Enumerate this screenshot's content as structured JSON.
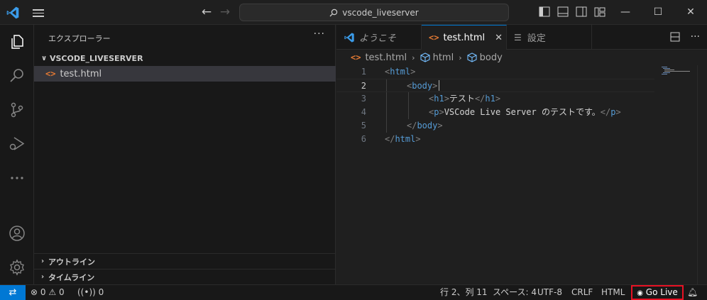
{
  "titlebar": {
    "search_text": "vscode_liveserver",
    "minimize": "—",
    "maximize": "☐",
    "close": "✕"
  },
  "sidebar": {
    "header": "エクスプローラー",
    "more": "···",
    "folder": "VSCODE_LIVESERVER",
    "file": "test.html",
    "outline": "アウトライン",
    "timeline": "タイムライン"
  },
  "tabs": [
    {
      "label": "ようこそ"
    },
    {
      "label": "test.html"
    },
    {
      "label": "設定"
    }
  ],
  "breadcrumb": [
    "test.html",
    "html",
    "body"
  ],
  "editor": {
    "line_numbers": [
      "1",
      "2",
      "3",
      "4",
      "5",
      "6"
    ],
    "lines": [
      {
        "t1": "<",
        "tag": "html",
        "t2": ">",
        "text": ""
      },
      {
        "t1": "<",
        "tag": "body",
        "t2": ">",
        "text": ""
      },
      {
        "t1": "<",
        "tag": "h1",
        "t2": ">",
        "text": "テスト",
        "t3": "</",
        "tag2": "h1",
        "t4": ">"
      },
      {
        "t1": "<",
        "tag": "p",
        "t2": ">",
        "text": "VSCode Live Server のテストです。",
        "t3": "</",
        "tag2": "p",
        "t4": ">"
      },
      {
        "t1": "</",
        "tag": "body",
        "t2": ">",
        "text": ""
      },
      {
        "t1": "</",
        "tag": "html",
        "t2": ">",
        "text": ""
      }
    ]
  },
  "statusbar": {
    "remote": "⇄",
    "errors": "0",
    "warnings": "0",
    "ports": "0",
    "position": "行 2、列 11",
    "spaces": "スペース: 4",
    "encoding": "UTF-8",
    "eol": "CRLF",
    "language": "HTML",
    "go_live": "Go Live"
  },
  "colors": {
    "accent": "#0078d4",
    "html_icon": "#e37933",
    "tag": "#569cd6",
    "highlight": "#e81123"
  }
}
